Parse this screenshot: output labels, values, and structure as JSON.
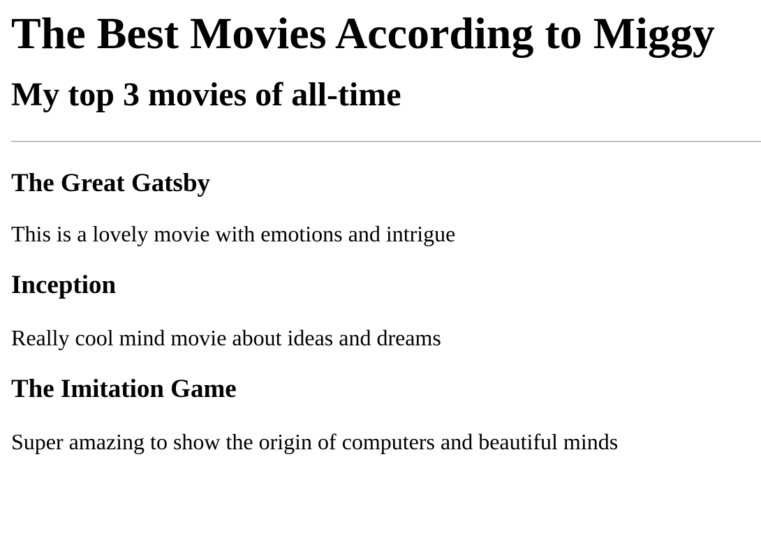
{
  "header": {
    "title": "The Best Movies According to Miggy",
    "subtitle": "My top 3 movies of all-time"
  },
  "movies": [
    {
      "title": "The Great Gatsby",
      "description": "This is a lovely movie with emotions and intrigue"
    },
    {
      "title": "Inception",
      "description": "Really cool mind movie about ideas and dreams"
    },
    {
      "title": "The Imitation Game",
      "description": "Super amazing to show the origin of computers and beautiful minds"
    }
  ]
}
